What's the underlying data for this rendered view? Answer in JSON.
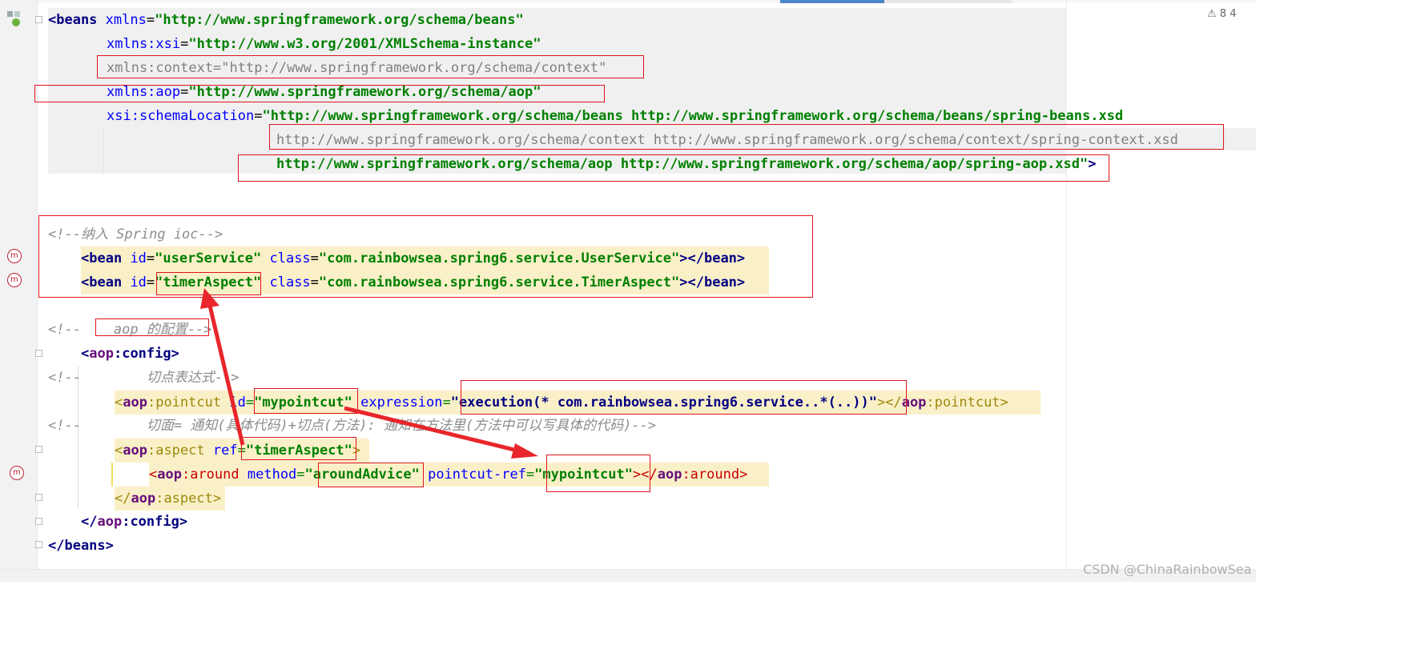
{
  "status": {
    "warnings": "⚠ 8",
    "extra": "4"
  },
  "watermark": "CSDN @ChinaRainbowSea",
  "code": {
    "l1": {
      "open": "<beans",
      "attr": "xmlns",
      "eq": "=",
      "val": "\"http://www.springframework.org/schema/beans\""
    },
    "l2": {
      "attr": "xmlns:xsi",
      "eq": "=",
      "val": "\"http://www.w3.org/2001/XMLSchema-instance\""
    },
    "l3": {
      "text": "xmlns:context=\"http://www.springframework.org/schema/context\""
    },
    "l4": {
      "attr": "xmlns:aop",
      "eq": "=",
      "val": "\"http://www.springframework.org/schema/aop\""
    },
    "l5": {
      "attr": "xsi:schemaLocation",
      "eq": "=",
      "val": "\"http://www.springframework.org/schema/beans http://www.springframework.org/schema/beans/spring-beans.xsd"
    },
    "l6": {
      "text": "http://www.springframework.org/schema/context http://www.springframework.org/schema/context/spring-context.xsd"
    },
    "l7": {
      "val": "http://www.springframework.org/schema/aop http://www.springframework.org/schema/aop/spring-aop.xsd\"",
      "close": ">"
    },
    "l8": {
      "comment": "<!--纳入 Spring ioc-->"
    },
    "l9": {
      "open": "<bean",
      "a1": "id",
      "v1": "\"userService\"",
      "a2": "class",
      "v2": "\"com.rainbowsea.spring6.service.UserService\"",
      "close": "></bean>"
    },
    "l10": {
      "open": "<bean",
      "a1": "id",
      "v1": "\"timerAspect\"",
      "a2": "class",
      "v2": "\"com.rainbowsea.spring6.service.TimerAspect\"",
      "close": "></bean>"
    },
    "l11": {
      "comment": "<!--    aop 的配置-->"
    },
    "l12": {
      "lt": "<",
      "ns": "aop",
      "tag": ":config",
      "gt": ">"
    },
    "l13": {
      "comment": "<!--        切点表达式-->"
    },
    "l14": {
      "lt": "<",
      "ns": "aop",
      "tag": ":pointcut",
      "a1": "id",
      "v1": "\"mypointcut\"",
      "a2": "expression",
      "v2": "\"execution(* com.rainbowsea.spring6.service..*(..))\"",
      "mid": "></",
      "ns2": "aop",
      "tag2": ":pointcut",
      "gt": ">"
    },
    "l15": {
      "comment": "<!--        切面= 通知(具体代码)+切点(方法): 通知在方法里(方法中可以写具体的代码)-->"
    },
    "l16": {
      "lt": "<",
      "ns": "aop",
      "tag": ":aspect",
      "a1": "ref",
      "v1": "\"timerAspect\"",
      "gt": ">"
    },
    "l17": {
      "lt": "<",
      "ns": "aop",
      "tag": ":around",
      "a1": "method",
      "v1": "\"aroundAdvice\"",
      "a2": "pointcut-ref",
      "v2": "\"mypointcut\"",
      "mid": "></",
      "ns2": "aop",
      "tag2": ":around",
      "gt": ">"
    },
    "l18": {
      "lt": "</",
      "ns": "aop",
      "tag": ":aspect",
      "gt": ">"
    },
    "l19": {
      "lt": "</",
      "ns": "aop",
      "tag": ":config",
      "gt": ">"
    },
    "l20": {
      "close": "</beans>"
    }
  },
  "colors": {
    "annotation_red": "#e0141c",
    "highlight_yellow": "#faf0c8",
    "string_green": "#008000",
    "tag_navy": "#000080",
    "attr_blue": "#0000ff"
  }
}
